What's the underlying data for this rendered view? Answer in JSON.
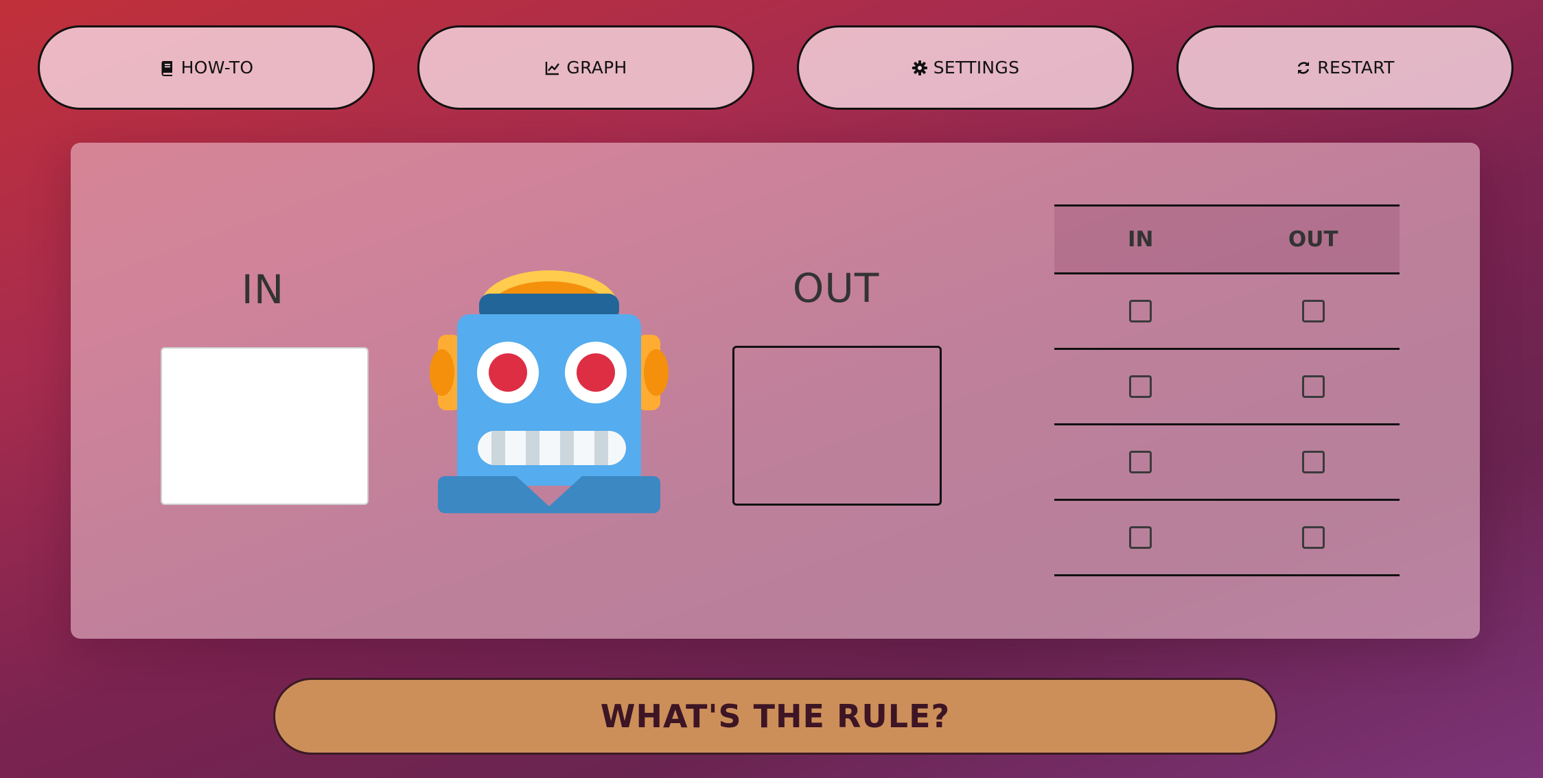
{
  "toolbar": {
    "howto_label": "HOW-TO",
    "graph_label": "GRAPH",
    "settings_label": "SETTINGS",
    "restart_label": "RESTART"
  },
  "machine": {
    "in_label": "IN",
    "out_label": "OUT",
    "in_value": "",
    "out_value": ""
  },
  "table": {
    "headers": [
      "IN",
      "OUT"
    ],
    "rows": [
      {
        "in_checked": false,
        "out_checked": false
      },
      {
        "in_checked": false,
        "out_checked": false
      },
      {
        "in_checked": false,
        "out_checked": false
      },
      {
        "in_checked": false,
        "out_checked": false
      }
    ]
  },
  "rule_button": {
    "label": "WHAT'S THE RULE?"
  },
  "icons": {
    "howto": "book-icon",
    "graph": "line-chart-icon",
    "settings": "gear-icon",
    "restart": "refresh-icon",
    "robot": "robot-icon"
  },
  "colors": {
    "rule_button": "#cd8f5a",
    "robot_body": "#55acee",
    "robot_eyes": "#dd2e44"
  }
}
